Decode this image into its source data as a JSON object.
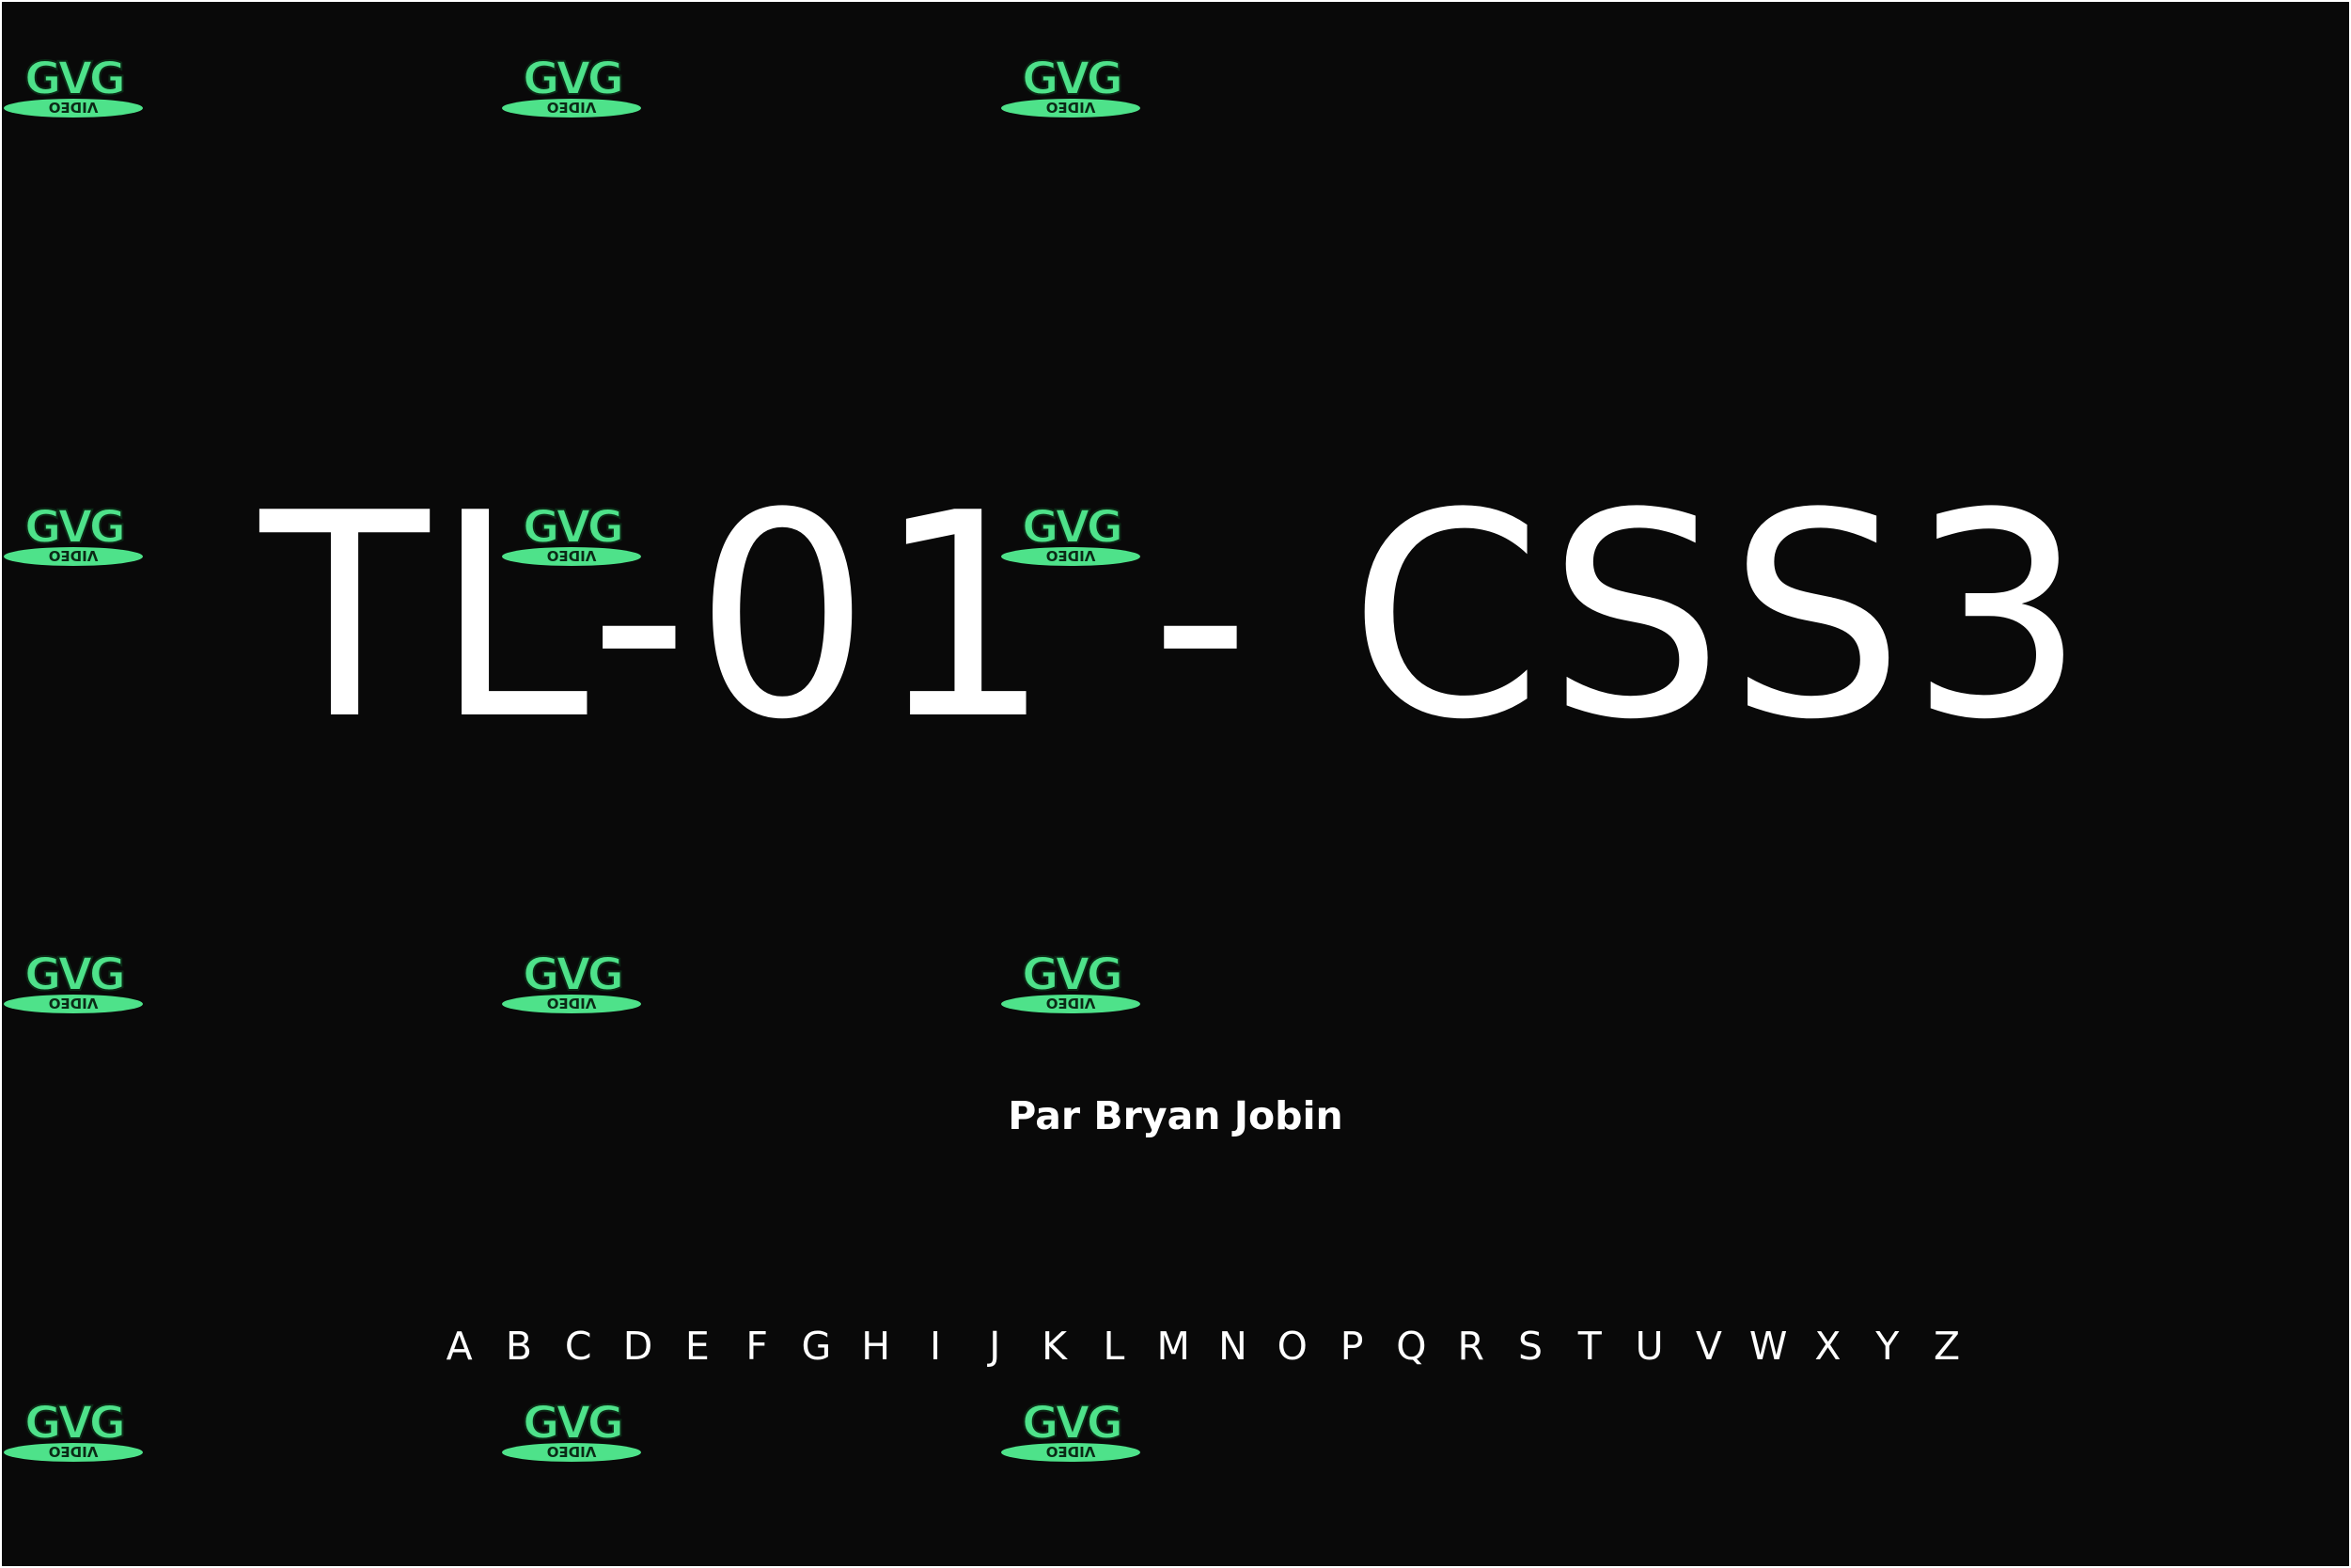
{
  "title": "TL-01 - CSS3",
  "byline": "Par Bryan Jobin",
  "alphabet": [
    "A",
    "B",
    "C",
    "D",
    "E",
    "F",
    "G",
    "H",
    "I",
    "J",
    "K",
    "L",
    "M",
    "N",
    "O",
    "P",
    "Q",
    "R",
    "S",
    "T",
    "U",
    "V",
    "W",
    "X",
    "Y",
    "Z"
  ],
  "watermark": {
    "icon": "gvg-video-logo",
    "text_top": "GVG",
    "text_bottom": "VIDEO"
  },
  "colors": {
    "background": "#090909",
    "text": "#ffffff",
    "logo_green": "#4ee28a",
    "logo_dark": "#0b2a16"
  }
}
